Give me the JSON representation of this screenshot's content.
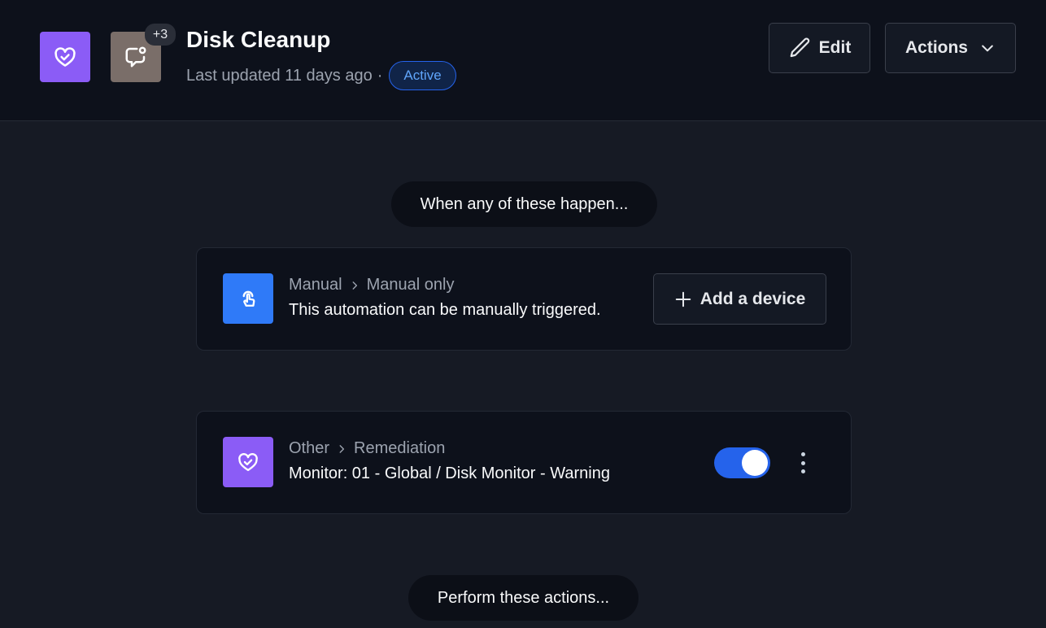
{
  "header": {
    "title": "Disk Cleanup",
    "last_updated": "Last updated 11 days ago",
    "separator": "·",
    "status": "Active",
    "participants_badge": "+3",
    "app_icon": "heart-check-icon",
    "chat_icon": "chat-notification-icon",
    "edit_label": "Edit",
    "actions_label": "Actions"
  },
  "workflow": {
    "when_label": "When any of these happen...",
    "perform_label": "Perform these actions...",
    "triggers": [
      {
        "category": "Manual",
        "subcategory": "Manual only",
        "description": "This automation can be manually triggered.",
        "icon": "touch-hand-icon",
        "button_label": "Add a device"
      },
      {
        "category": "Other",
        "subcategory": "Remediation",
        "description": "Monitor: 01 - Global / Disk Monitor - Warning",
        "icon": "heart-check-icon",
        "enabled": true
      }
    ]
  },
  "colors": {
    "accent_blue": "#2563eb",
    "purple": "#8b5cf6",
    "header_bg": "#0d111b",
    "page_bg": "#161a24"
  }
}
